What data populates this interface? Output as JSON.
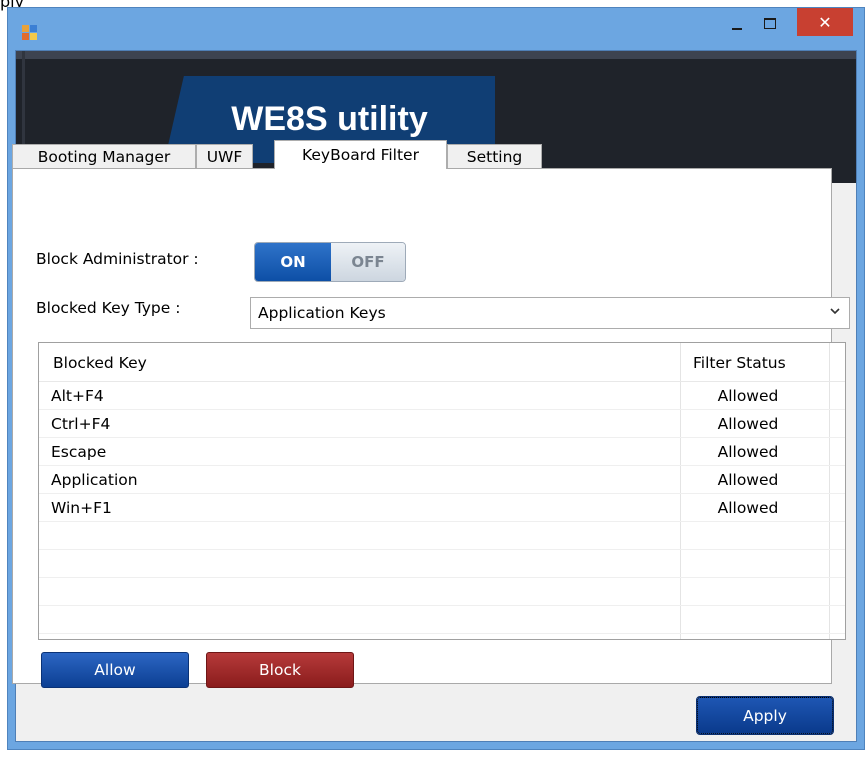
{
  "page_caption": "ply",
  "window": {
    "controls": {
      "minimize": "minimize",
      "maximize": "maximize",
      "close": "✕"
    }
  },
  "banner": {
    "title": "WE8S utility"
  },
  "tabs": [
    {
      "label": "Booting Manager",
      "active": false
    },
    {
      "label": "UWF",
      "active": false
    },
    {
      "label": "KeyBoard Filter",
      "active": true
    },
    {
      "label": "Setting",
      "active": false
    }
  ],
  "keyboard_filter": {
    "block_admin_label": "Block Administrator :",
    "toggle": {
      "on_label": "ON",
      "off_label": "OFF",
      "state": "ON"
    },
    "key_type_label": "Blocked Key Type :",
    "key_type_value": "Application Keys",
    "table": {
      "columns": [
        "Blocked Key",
        "Filter Status"
      ],
      "rows": [
        {
          "key": "Alt+F4",
          "status": "Allowed"
        },
        {
          "key": "Ctrl+F4",
          "status": "Allowed"
        },
        {
          "key": "Escape",
          "status": "Allowed"
        },
        {
          "key": "Application",
          "status": "Allowed"
        },
        {
          "key": "Win+F1",
          "status": "Allowed"
        }
      ]
    },
    "buttons": {
      "allow": "Allow",
      "block": "Block",
      "apply": "Apply"
    }
  },
  "colors": {
    "window_frame": "#6ca6e1",
    "banner_bg": "#1f232a",
    "banner_title_bg": "#103e74",
    "allow_button": "#1a4fa8",
    "block_button": "#a02a2a",
    "close_button": "#c84031"
  }
}
